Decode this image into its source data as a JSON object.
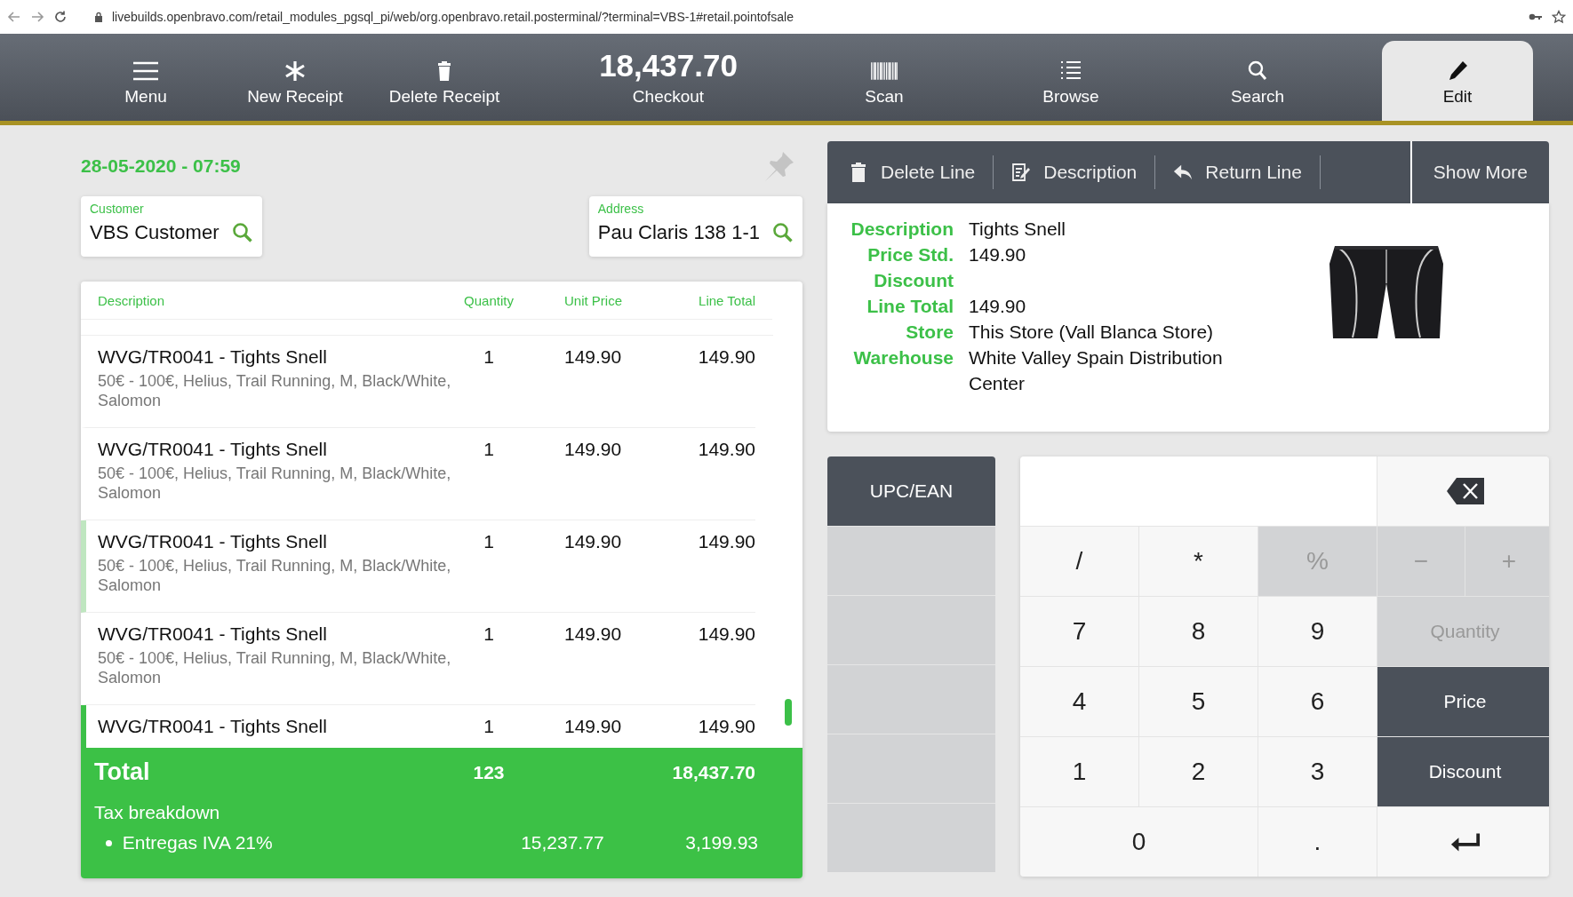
{
  "browser": {
    "url": "livebuilds.openbravo.com/retail_modules_pgsql_pi/web/org.openbravo.retail.posterminal/?terminal=VBS-1#retail.pointofsale"
  },
  "toolbar": [
    {
      "kind": "icon",
      "label": "Menu",
      "selected": false
    },
    {
      "kind": "icon",
      "label": "New Receipt",
      "selected": false
    },
    {
      "kind": "icon",
      "label": "Delete Receipt",
      "selected": false
    },
    {
      "kind": "amount",
      "amount": "18,437.70",
      "label": "Checkout",
      "selected": false
    },
    {
      "kind": "icon",
      "label": "Scan",
      "selected": false
    },
    {
      "kind": "icon",
      "label": "Browse",
      "selected": false
    },
    {
      "kind": "icon",
      "label": "Search",
      "selected": false
    },
    {
      "kind": "icon",
      "label": "Edit",
      "selected": true
    }
  ],
  "receipt": {
    "date": "28-05-2020 - 07:59",
    "customer": {
      "label": "Customer",
      "value": "VBS Customer"
    },
    "address": {
      "label": "Address",
      "value": "Pau Claris 138 1-1"
    },
    "columns": [
      "Description",
      "Quantity",
      "Unit Price",
      "Line Total"
    ],
    "lines": [
      {
        "description": "WVG/TR0041 - Tights Snell",
        "attributes": "50€ - 100€, Helius, Trail Running, M, Black/White, Salomon",
        "quantity": "1",
        "unit_price": "149.90",
        "line_total": "149.90",
        "hovered": false,
        "selected": false
      },
      {
        "description": "WVG/TR0041 - Tights Snell",
        "attributes": "50€ - 100€, Helius, Trail Running, M, Black/White, Salomon",
        "quantity": "1",
        "unit_price": "149.90",
        "line_total": "149.90",
        "hovered": false,
        "selected": false
      },
      {
        "description": "WVG/TR0041 - Tights Snell",
        "attributes": "50€ - 100€, Helius, Trail Running, M, Black/White, Salomon",
        "quantity": "1",
        "unit_price": "149.90",
        "line_total": "149.90",
        "hovered": true,
        "selected": false
      },
      {
        "description": "WVG/TR0041 - Tights Snell",
        "attributes": "50€ - 100€, Helius, Trail Running, M, Black/White, Salomon",
        "quantity": "1",
        "unit_price": "149.90",
        "line_total": "149.90",
        "hovered": false,
        "selected": false
      },
      {
        "description": "WVG/TR0041 - Tights Snell",
        "quantity": "1",
        "unit_price": "149.90",
        "line_total": "149.90",
        "hovered": false,
        "selected": true
      }
    ],
    "total": {
      "label": "Total",
      "quantity": "123",
      "amount": "18,437.70"
    },
    "tax_breakdown": {
      "title": "Tax breakdown",
      "items": [
        {
          "name": "Entregas IVA 21%",
          "base": "15,237.77",
          "amount": "3,199.93"
        }
      ]
    }
  },
  "line_actions": [
    {
      "kind": "delete",
      "label": "Delete Line"
    },
    {
      "kind": "description",
      "label": "Description"
    },
    {
      "kind": "return",
      "label": "Return Line"
    }
  ],
  "show_more": "Show More",
  "line_details": [
    {
      "label": "Description",
      "value": "Tights Snell"
    },
    {
      "label": "Price Std.",
      "value": "149.90"
    },
    {
      "label": "Discount"
    },
    {
      "label": "Line Total",
      "value": "149.90"
    },
    {
      "label": "Store",
      "value": "This Store (Vall Blanca Store)"
    },
    {
      "label": "Warehouse",
      "value": "White Valley Spain Distribution Center"
    }
  ],
  "scan_modes": [
    {
      "label": "UPC/EAN",
      "selected": true
    }
  ],
  "keypad": [
    {
      "kind": "display"
    },
    {
      "kind": "backspace",
      "disabled": false
    },
    {
      "kind": "key",
      "label": "/",
      "disabled": false
    },
    {
      "kind": "key",
      "label": "*",
      "disabled": false
    },
    {
      "kind": "key",
      "label": "%",
      "disabled": true
    },
    {
      "kind": "key",
      "label": "−",
      "disabled": true
    },
    {
      "kind": "key",
      "label": "+",
      "disabled": true
    },
    {
      "kind": "key",
      "label": "7",
      "disabled": false
    },
    {
      "kind": "key",
      "label": "8",
      "disabled": false
    },
    {
      "kind": "key",
      "label": "9",
      "disabled": false
    },
    {
      "kind": "mode",
      "label": "Quantity",
      "disabled": true
    },
    {
      "kind": "key",
      "label": "4",
      "disabled": false
    },
    {
      "kind": "key",
      "label": "5",
      "disabled": false
    },
    {
      "kind": "key",
      "label": "6",
      "disabled": false
    },
    {
      "kind": "mode",
      "label": "Price",
      "disabled": false
    },
    {
      "kind": "key",
      "label": "1",
      "disabled": false
    },
    {
      "kind": "key",
      "label": "2",
      "disabled": false
    },
    {
      "kind": "key",
      "label": "3",
      "disabled": false
    },
    {
      "kind": "mode",
      "label": "Discount",
      "disabled": false
    },
    {
      "kind": "wide",
      "label": "0",
      "disabled": false
    },
    {
      "kind": "key",
      "label": ".",
      "disabled": false
    },
    {
      "kind": "enter",
      "disabled": false
    }
  ]
}
